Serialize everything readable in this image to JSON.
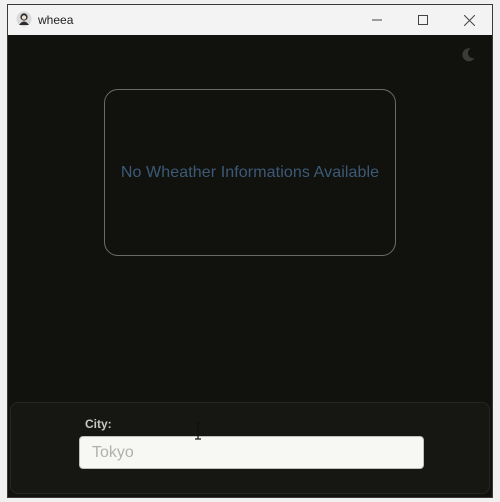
{
  "window": {
    "title": "wheea",
    "controls": {
      "minimize_icon": "minimize-icon",
      "maximize_icon": "maximize-icon",
      "close_icon": "close-icon"
    }
  },
  "header": {
    "theme_toggle_icon": "moon-icon"
  },
  "weather": {
    "empty_message": "No Wheather Informations Available"
  },
  "form": {
    "city_label": "City:",
    "city_placeholder": "Tokyo",
    "city_value": ""
  },
  "colors": {
    "background": "#11110e",
    "card_border": "#6a6a66",
    "message_text": "#3c5a78",
    "input_background": "#f7f7f4"
  }
}
